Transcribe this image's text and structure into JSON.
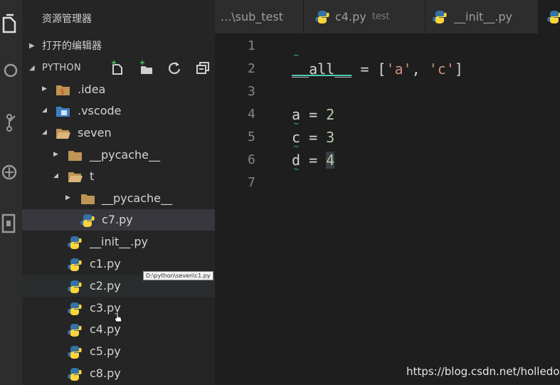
{
  "sidebar": {
    "title": "资源管理器",
    "open_editors": "打开的编辑器",
    "project": "PYTHON"
  },
  "tree": [
    {
      "label": ".idea",
      "kind": "folder-idea",
      "twisty": "closed"
    },
    {
      "label": ".vscode",
      "kind": "folder-vscode",
      "twisty": "open"
    },
    {
      "label": "seven",
      "kind": "folder",
      "twisty": "open"
    },
    {
      "label": "__pycache__",
      "kind": "folder",
      "twisty": "closed"
    },
    {
      "label": "t",
      "kind": "folder",
      "twisty": "open"
    },
    {
      "label": "__pycache__",
      "kind": "folder",
      "twisty": "closed"
    },
    {
      "label": "c7.py",
      "kind": "python"
    },
    {
      "label": "__init__.py",
      "kind": "python"
    },
    {
      "label": "c1.py",
      "kind": "python"
    },
    {
      "label": "c2.py",
      "kind": "python"
    },
    {
      "label": "c3.py",
      "kind": "python"
    },
    {
      "label": "c4.py",
      "kind": "python"
    },
    {
      "label": "c5.py",
      "kind": "python"
    },
    {
      "label": "c8.py",
      "kind": "python"
    }
  ],
  "tooltip": "D:\\python\\seven\\c1.py",
  "tabs": [
    {
      "label": "...\\sub_test",
      "description": ""
    },
    {
      "label": "c4.py",
      "description": "test"
    },
    {
      "label": "__init__.py",
      "description": ""
    }
  ],
  "editor": {
    "line_numbers": [
      "1",
      "2",
      "3",
      "4",
      "5",
      "6",
      "7"
    ],
    "code": {
      "l2_name": "__all__",
      "l2_eq": " = [",
      "l2_s1": "'a'",
      "l2_sep": ", ",
      "l2_s2": "'c'",
      "l2_close": "]",
      "l4_lhs": "a = ",
      "l4_val": "2",
      "l5_lhs": "c = ",
      "l5_val": "3",
      "l6_lhs": "d = ",
      "l6_val": "4"
    }
  },
  "watermark": "https://blog.csdn.net/holledog",
  "colors": {
    "editor_bg": "#1e1e1e",
    "sidebar_bg": "#252526",
    "string": "#ce9178",
    "number": "#b5cea8",
    "python_blue": "#3572a5",
    "python_yellow": "#ffd43b"
  }
}
